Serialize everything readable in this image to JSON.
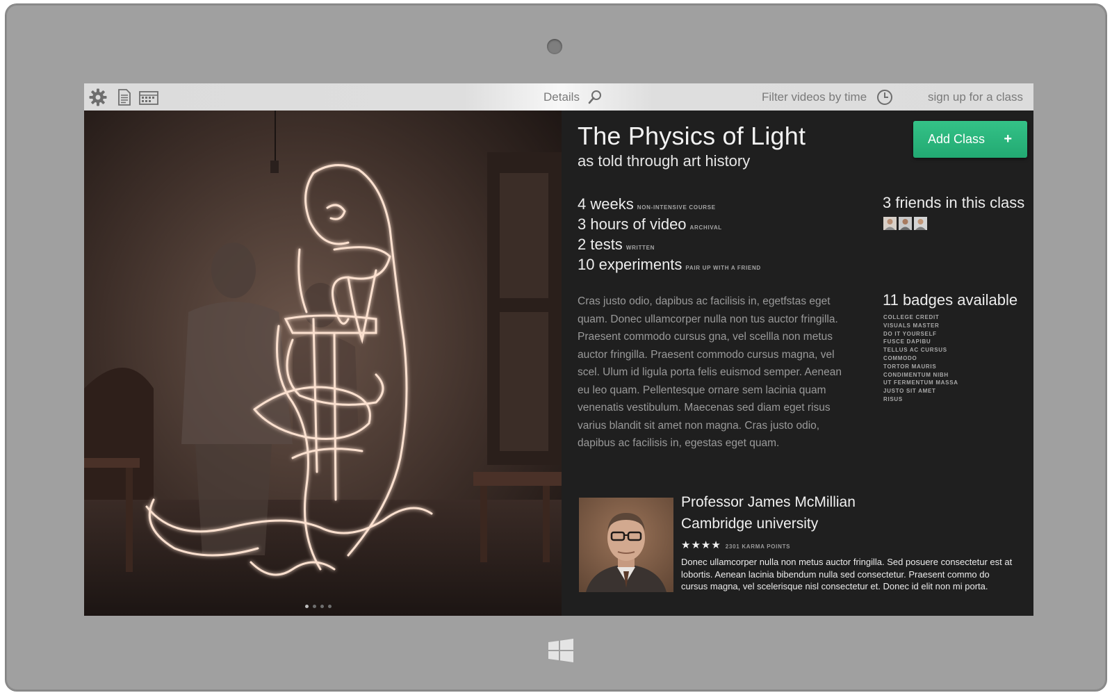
{
  "appbar": {
    "details_label": "Details",
    "filter_label": "Filter videos by time",
    "signup_label": "sign up for a class"
  },
  "course": {
    "title": "The Physics of Light",
    "subtitle": "as told through art history",
    "add_button_label": "Add Class",
    "add_button_icon": "+",
    "stats": [
      {
        "value": "4 weeks",
        "note": "non-intensive course"
      },
      {
        "value": "3 hours of video",
        "note": "archival"
      },
      {
        "value": "2 tests",
        "note": "written"
      },
      {
        "value": "10 experiments",
        "note": "pair up with a friend"
      }
    ],
    "description": "Cras justo odio, dapibus ac facilisis in, egetfstas eget quam. Donec ullamcorper nulla non tus auctor fringilla. Praesent commodo cursus gna, vel scellla non metus auctor fringilla. Praesent commodo cursus magna, vel scel. Ulum id ligula porta felis euismod semper. Aenean eu leo quam. Pellentesque ornare sem lacinia quam venenatis vestibulum. Maecenas sed diam eget risus varius blandit sit amet non magna. Cras justo odio, dapibus ac facilisis in, egestas eget quam."
  },
  "friends": {
    "title": "3 friends in this class",
    "count": 3
  },
  "badges": {
    "title": "11 badges available",
    "items": [
      "college credit",
      "visuals master",
      "do it yourself",
      "fusce dapibu",
      "tellus ac cursus",
      "commodo",
      "tortor mauris",
      "condimentum nibh",
      "ut fermentum massa",
      "justo sit amet",
      "risus"
    ]
  },
  "professor": {
    "name": "Professor James McMillian",
    "university": "Cambridge university",
    "stars": "★★★★",
    "rating": 4,
    "karma": "2301 karma points",
    "bio": "Donec ullamcorper nulla non metus auctor fringilla. Sed posuere consectetur est at lobortis. Aenean lacinia bibendum nulla sed consectetur. Praesent commo do cursus magna, vel scelerisque nisl consectetur et. Donec id elit non mi porta."
  },
  "gallery": {
    "page_count": 4,
    "active_page": 1
  },
  "colors": {
    "accent_green": "#2bb57c",
    "panel_dark": "#1f1f1f",
    "device_frame": "#a0a0a0"
  },
  "icons": [
    "gear-icon",
    "document-icon",
    "calendar-icon",
    "search-icon",
    "clock-icon",
    "plus-icon",
    "windows-logo-icon"
  ]
}
